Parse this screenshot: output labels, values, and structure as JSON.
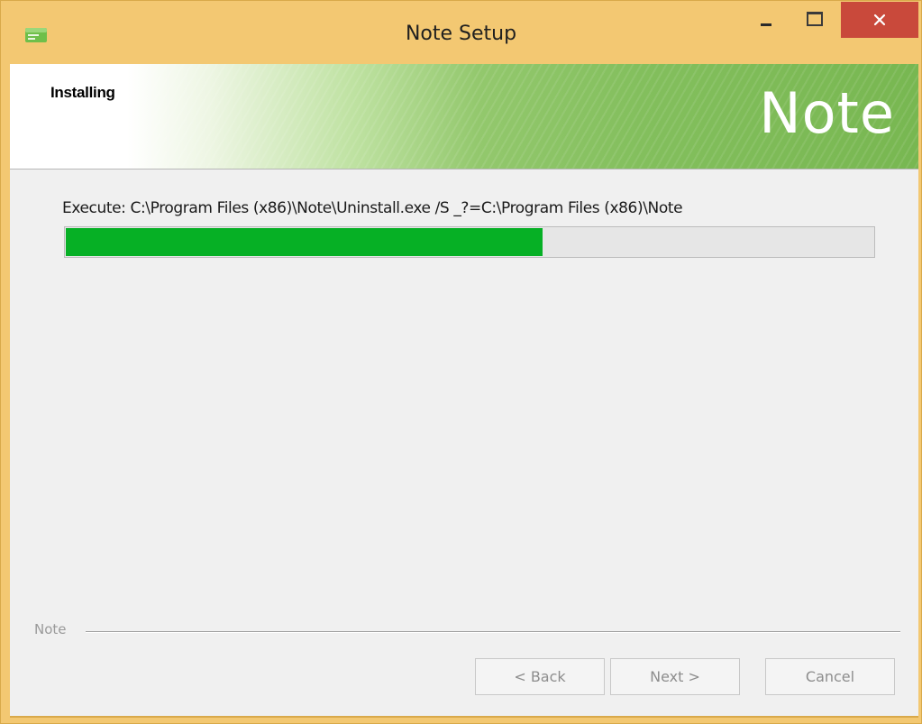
{
  "window": {
    "title": "Note Setup",
    "close_label": "×"
  },
  "header": {
    "heading": "Installing",
    "brand": "Note"
  },
  "main": {
    "status_text": "Execute: C:\\Program Files (x86)\\Note\\Uninstall.exe /S _?=C:\\Program Files (x86)\\Note",
    "progress_percent": 59
  },
  "footer": {
    "branding": "Note",
    "buttons": {
      "back": "< Back",
      "next": "Next >",
      "cancel": "Cancel"
    }
  },
  "colors": {
    "titlebar": "#f3c872",
    "close_button": "#c9493b",
    "progress_fill": "#06b025",
    "header_green": "#78b751"
  },
  "icons": {
    "app": "note-app-icon",
    "minimize": "minimize-icon",
    "maximize": "maximize-icon",
    "close": "close-icon"
  }
}
